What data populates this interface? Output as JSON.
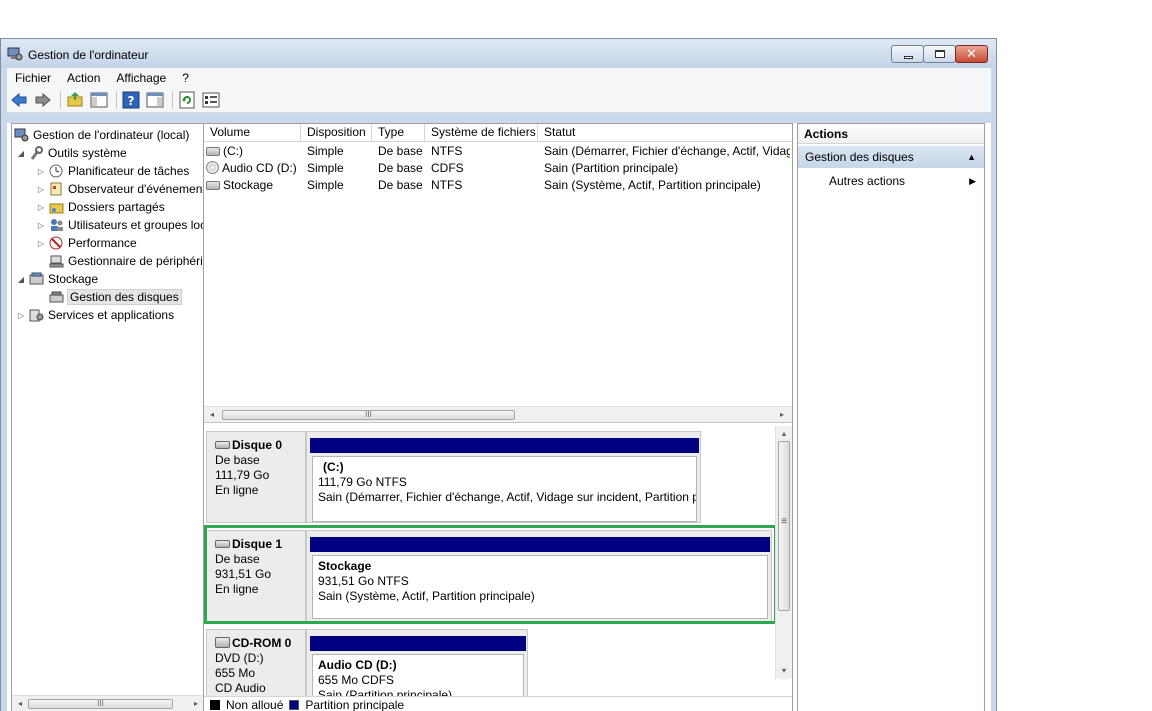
{
  "window": {
    "title": "Gestion de l'ordinateur",
    "close_glyph": "✕"
  },
  "menu": [
    "Fichier",
    "Action",
    "Affichage",
    "?"
  ],
  "toolbar": [
    "back-icon",
    "forward-icon",
    "up-folder-icon",
    "show-hide-tree-icon",
    "help-icon",
    "show-hide-action-pane-icon",
    "refresh-icon",
    "properties-icon"
  ],
  "tree": {
    "root": "Gestion de l'ordinateur (local)",
    "outils": "Outils système",
    "planificateur": "Planificateur de tâches",
    "observateur": "Observateur d'événements",
    "dossiers": "Dossiers partagés",
    "utilisateurs": "Utilisateurs et groupes locaux",
    "performance": "Performance",
    "gestionnaire": "Gestionnaire de périphériques",
    "stockage": "Stockage",
    "gestion_disques": "Gestion des disques",
    "services": "Services et applications"
  },
  "volumes": {
    "headers": [
      "Volume",
      "Disposition",
      "Type",
      "Système de fichiers",
      "Statut"
    ],
    "rows": [
      [
        "(C:)",
        "Simple",
        "De base",
        "NTFS",
        "Sain (Démarrer, Fichier d'échange, Actif, Vidage sur incident, Partition principale)"
      ],
      [
        "Audio CD (D:)",
        "Simple",
        "De base",
        "CDFS",
        "Sain (Partition principale)"
      ],
      [
        "Stockage",
        "Simple",
        "De base",
        "NTFS",
        "Sain (Système, Actif, Partition principale)"
      ]
    ]
  },
  "scroll": {
    "left": "◂",
    "right": "▸",
    "up": "▴",
    "down": "▾",
    "grip": "III",
    "vgrip": "≡"
  },
  "disks": [
    {
      "name": "Disque 0",
      "type": "De base",
      "size": "111,79 Go",
      "status": "En ligne",
      "part_name": "(C:)",
      "part_size": "111,79 Go NTFS",
      "part_status": "Sain (Démarrer, Fichier d'échange, Actif, Vidage sur incident, Partition principale)"
    },
    {
      "name": "Disque 1",
      "type": "De base",
      "size": "931,51 Go",
      "status": "En ligne",
      "part_name": "Stockage",
      "part_size": "931,51 Go NTFS",
      "part_status": "Sain (Système, Actif, Partition principale)"
    },
    {
      "name": "CD-ROM 0",
      "type": "DVD (D:)",
      "size": "655 Mo",
      "status": "CD Audio",
      "part_name": "Audio CD  (D:)",
      "part_size": "655 Mo CDFS",
      "part_status": "Sain (Partition principale)"
    }
  ],
  "legend": {
    "unallocated": "Non alloué",
    "primary": "Partition principale"
  },
  "actions": {
    "header": "Actions",
    "section": "Gestion des disques",
    "section_glyph": "▲",
    "item": "Autres actions",
    "item_glyph": "▶"
  },
  "colors": {
    "partition": "#000080",
    "unallocated": "#000000",
    "highlight": "#2fa84f"
  }
}
